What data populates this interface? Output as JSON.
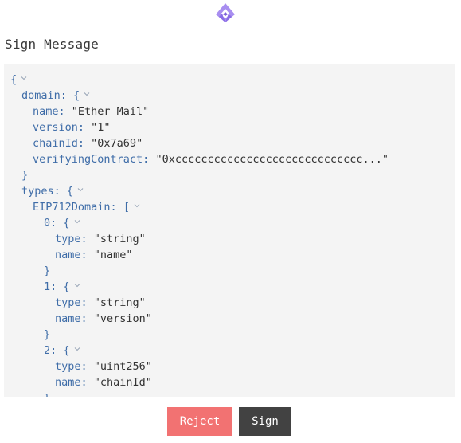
{
  "header": {
    "logo_icon": "arbitrum-logo-icon",
    "title": "Sign Message"
  },
  "colors": {
    "accent": "#9b7fe0",
    "key": "#3f6da8",
    "reject": "#f27272",
    "sign": "#424242",
    "panel_bg": "#f4f4f4"
  },
  "message_tree": [
    {
      "indent": 0,
      "text": "{",
      "chevron": true
    },
    {
      "indent": 1,
      "key": "domain",
      "open": "{",
      "chevron": true
    },
    {
      "indent": 2,
      "key": "name",
      "value": "\"Ether Mail\""
    },
    {
      "indent": 2,
      "key": "version",
      "value": "\"1\""
    },
    {
      "indent": 2,
      "key": "chainId",
      "value": "\"0x7a69\""
    },
    {
      "indent": 2,
      "key": "verifyingContract",
      "value": "\"0xccccccccccccccccccccccccccccc...\""
    },
    {
      "indent": 1,
      "text": "}"
    },
    {
      "indent": 1,
      "key": "types",
      "open": "{",
      "chevron": true
    },
    {
      "indent": 2,
      "key": "EIP712Domain",
      "open": "[",
      "chevron": true
    },
    {
      "indent": 3,
      "key": "0",
      "open": "{",
      "chevron": true
    },
    {
      "indent": 4,
      "key": "type",
      "value": "\"string\""
    },
    {
      "indent": 4,
      "key": "name",
      "value": "\"name\""
    },
    {
      "indent": 3,
      "text": "}"
    },
    {
      "indent": 3,
      "key": "1",
      "open": "{",
      "chevron": true
    },
    {
      "indent": 4,
      "key": "type",
      "value": "\"string\""
    },
    {
      "indent": 4,
      "key": "name",
      "value": "\"version\""
    },
    {
      "indent": 3,
      "text": "}"
    },
    {
      "indent": 3,
      "key": "2",
      "open": "{",
      "chevron": true
    },
    {
      "indent": 4,
      "key": "type",
      "value": "\"uint256\""
    },
    {
      "indent": 4,
      "key": "name",
      "value": "\"chainId\""
    },
    {
      "indent": 3,
      "text": "}"
    }
  ],
  "actions": {
    "reject_label": "Reject",
    "sign_label": "Sign"
  }
}
